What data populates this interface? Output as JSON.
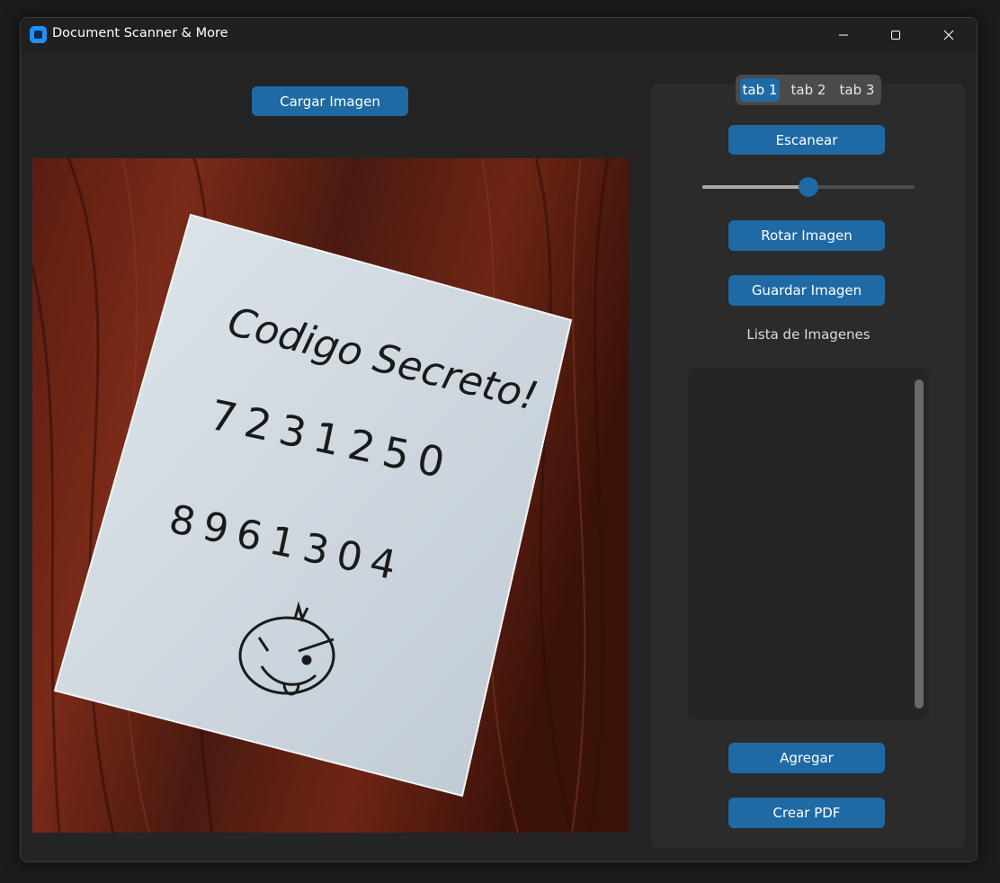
{
  "window": {
    "title": "Document Scanner & More"
  },
  "buttons": {
    "load_image": "Cargar Imagen",
    "scan": "Escanear",
    "rotate": "Rotar Imagen",
    "save": "Guardar Imagen",
    "add": "Agregar",
    "create_pdf": "Crear PDF"
  },
  "tabs": [
    {
      "label": "tab 1",
      "active": true
    },
    {
      "label": "tab 2",
      "active": false
    },
    {
      "label": "tab 3",
      "active": false
    }
  ],
  "slider": {
    "value_fraction": 0.5
  },
  "list": {
    "label": "Lista de Imagenes",
    "items": []
  },
  "photo": {
    "note_line1": "Codigo Secreto!",
    "note_line2": "7231250",
    "note_line3": "8961304"
  },
  "colors": {
    "accent": "#1f6aa5",
    "window_bg": "#242424",
    "panel_bg": "#2b2b2b",
    "titlebar_bg": "#202020"
  }
}
